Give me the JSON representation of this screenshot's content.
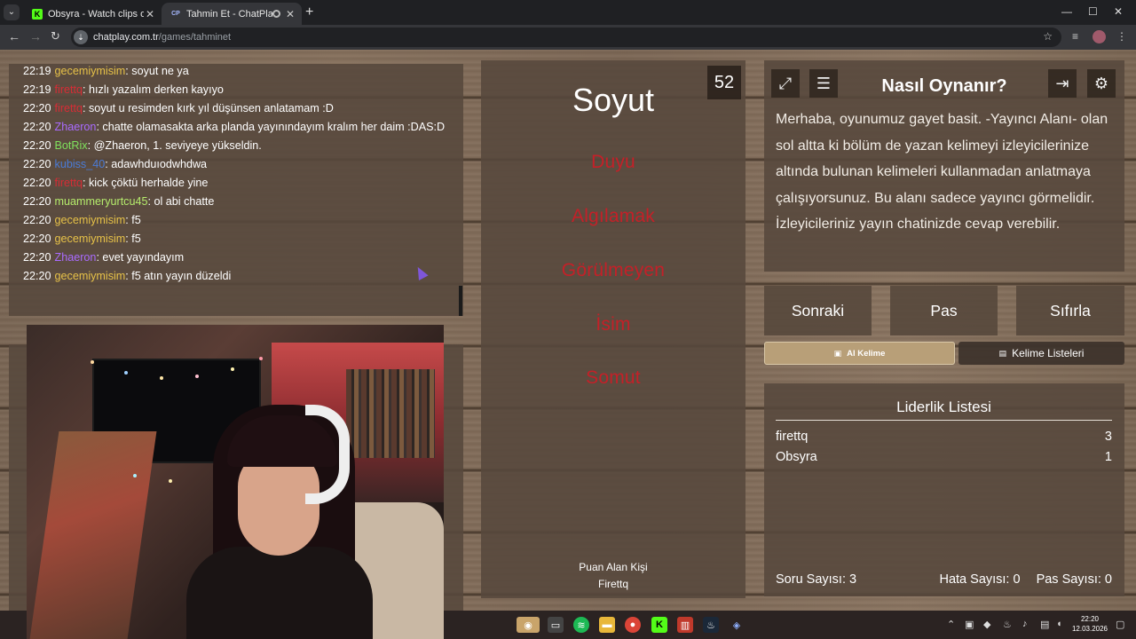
{
  "browser": {
    "tabs": [
      {
        "title": "Obsyra - Watch clips on Kick",
        "favicon": "kick-icon",
        "active": false
      },
      {
        "title": "Tahmin Et - ChatPlay",
        "favicon": "chatplay-icon",
        "favicon_text": "CP",
        "active": true
      }
    ],
    "url_host": "chatplay.com.tr",
    "url_path": "/games/tahminet"
  },
  "chat": {
    "messages": [
      {
        "time": "22:19",
        "user": "gecemiymisim",
        "color": "yellow",
        "text": ": soyut ne ya"
      },
      {
        "time": "22:19",
        "user": "firettq",
        "color": "red",
        "text": ": hızlı yazalım derken kayıyo"
      },
      {
        "time": "22:20",
        "user": "firettq",
        "color": "red",
        "text": ": soyut u resimden kırk yıl düşünsen anlatamam :D"
      },
      {
        "time": "22:20",
        "user": "Zhaeron",
        "color": "purple",
        "text": ": chatte olamasakta arka planda yayınındayım kralım her daim :DAS:D"
      },
      {
        "time": "22:20",
        "user": "BotRix",
        "color": "green",
        "text": ": @Zhaeron, 1. seviyeye yükseldin."
      },
      {
        "time": "22:20",
        "user": "kubiss_40",
        "color": "blue",
        "text": ": adawhduıodwhdwa"
      },
      {
        "time": "22:20",
        "user": "firettq",
        "color": "red",
        "text": ": kick çöktü herhalde yine"
      },
      {
        "time": "22:20",
        "user": "muammeryurtcu45",
        "color": "lime",
        "text": ": ol abi chatte"
      },
      {
        "time": "22:20",
        "user": "gecemiymisim",
        "color": "yellow",
        "text": ": f5"
      },
      {
        "time": "22:20",
        "user": "gecemiymisim",
        "color": "yellow",
        "text": ": f5"
      },
      {
        "time": "22:20",
        "user": "Zhaeron",
        "color": "purple",
        "text": ": evet yayındayım"
      },
      {
        "time": "22:20",
        "user": "gecemiymisim",
        "color": "yellow",
        "text": ": f5 atın yayın düzeldi"
      }
    ]
  },
  "game": {
    "timer": "52",
    "word": "Soyut",
    "forbidden": [
      "Duyu",
      "Algılamak",
      "Görülmeyen",
      "İsim",
      "Somut"
    ],
    "scorer_label": "Puan Alan Kişi",
    "scorer_name": "Firettq"
  },
  "howto": {
    "title": "Nasıl Oynanır?",
    "text": "Merhaba, oyunumuz gayet basit. -Yayıncı Alanı- olan sol altta ki bölüm de yazan kelimeyi izleyicilerinize altında bulunan kelimeleri kullanmadan anlatmaya çalışıyorsunuz. Bu alanı sadece yayıncı görmelidir. İzleyicileriniz yayın chatinizde cevap verebilir."
  },
  "actions": {
    "next": "Sonraki",
    "pass": "Pas",
    "reset": "Sıfırla",
    "get_word": "Al Kelime",
    "word_lists": "Kelime Listeleri"
  },
  "leaderboard": {
    "title": "Liderlik Listesi",
    "rows": [
      {
        "name": "firettq",
        "score": "3"
      },
      {
        "name": "Obsyra",
        "score": "1"
      }
    ],
    "question_count": "Soru Sayısı: 3",
    "error_count": "Hata Sayısı: 0",
    "pass_count": "Pas Sayısı: 0"
  },
  "taskbar": {
    "time": "22:20",
    "date": "12.03.2026"
  },
  "colors": {
    "yellow": "#e7c248",
    "red": "#d72c35",
    "purple": "#a96bff",
    "green": "#7fe15d",
    "blue": "#4a7bd6",
    "lime": "#b5ec6c",
    "forbidden_word": "#c42028"
  }
}
